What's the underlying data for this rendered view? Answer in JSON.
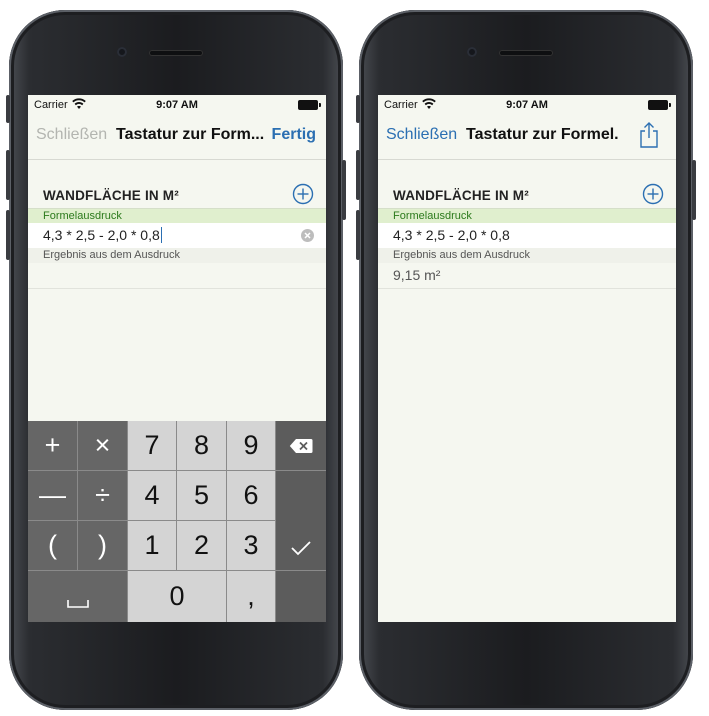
{
  "status_bar": {
    "carrier": "Carrier",
    "time": "9:07 AM"
  },
  "left_screen": {
    "nav": {
      "left_label": "Schließen",
      "title": "Tastatur zur Form...",
      "right_label": "Fertig"
    },
    "section_title": "WANDFLÄCHE IN M²",
    "formula_label": "Formelausdruck",
    "formula_value": "4,3 * 2,5 - 2,0 * 0,8",
    "result_label": "Ergebnis aus dem Ausdruck",
    "result_value": "",
    "keypad": {
      "row1": [
        "+",
        "×",
        "7",
        "8",
        "9"
      ],
      "row2": [
        "—",
        "÷",
        "4",
        "5",
        "6"
      ],
      "row3": [
        "(",
        ")",
        "1",
        "2",
        "3"
      ],
      "row4": [
        "␣",
        "0",
        ","
      ],
      "icons": {
        "backspace": "backspace-icon",
        "confirm": "checkmark-icon",
        "space": "space-icon"
      }
    }
  },
  "right_screen": {
    "nav": {
      "left_label": "Schließen",
      "title": "Tastatur zur Formel...",
      "right_icon": "share-icon"
    },
    "section_title": "WANDFLÄCHE IN M²",
    "formula_label": "Formelausdruck",
    "formula_value": "4,3 * 2,5 - 2,0 * 0,8",
    "result_label": "Ergebnis aus dem Ausdruck",
    "result_value": "9,15 m²"
  },
  "colors": {
    "accent": "#2b6fb2",
    "label_green": "#2c7a1c",
    "label_green_bg": "#e0efce",
    "screen_bg": "#f5f7f0"
  }
}
